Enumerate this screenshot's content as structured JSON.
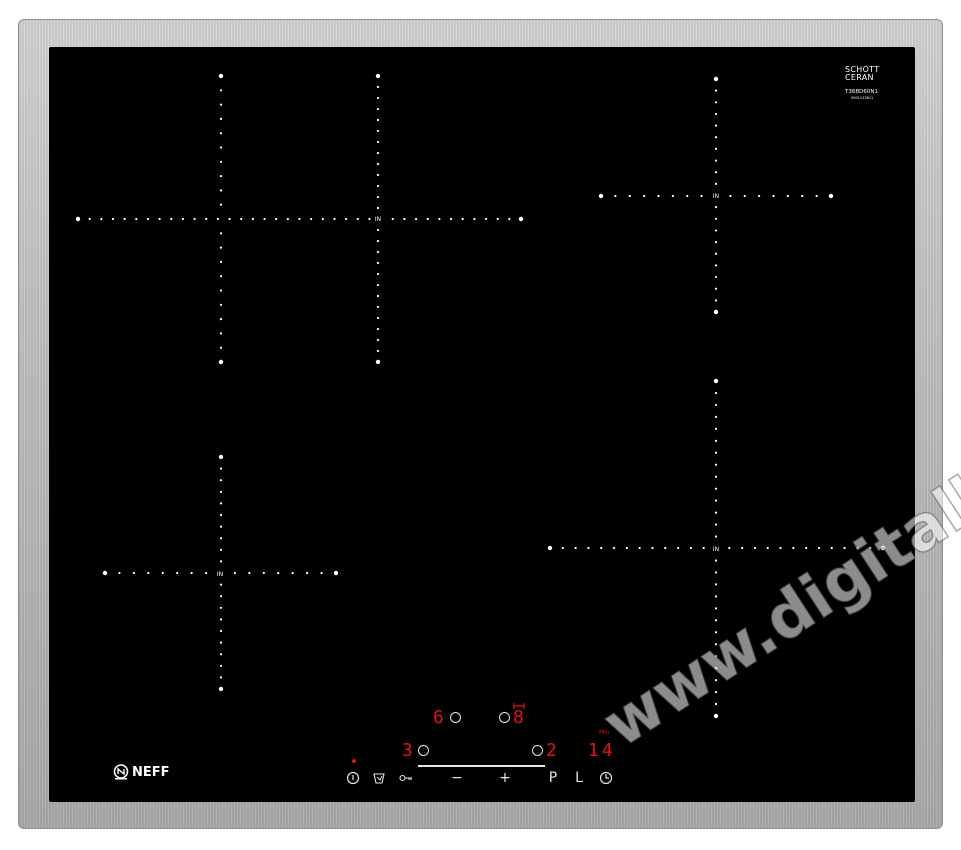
{
  "brand": {
    "schott_line1": "SCHOTT",
    "schott_line2": "CERAN",
    "model": "T36BD60N1",
    "serial": "9001133611",
    "neff": "NEFF"
  },
  "zone_marker": "IN",
  "display": {
    "power_top_left": "6",
    "power_top_right": "8",
    "power_bottom_left": "3",
    "power_bottom_right": "2",
    "timer": "14",
    "timer_unit": "Min"
  },
  "controls": {
    "power_icon": "power-icon",
    "cooking_icon": "boost-icon",
    "key_icon": "key-lock-icon",
    "minus": "−",
    "plus": "+",
    "p_label": "P",
    "l_label": "L",
    "timer_icon": "timer-icon"
  },
  "watermark": "www.digitalko.hu",
  "colors": {
    "glass": "#000000",
    "display_red": "#e0121b",
    "frame": "#bdbdbd"
  }
}
